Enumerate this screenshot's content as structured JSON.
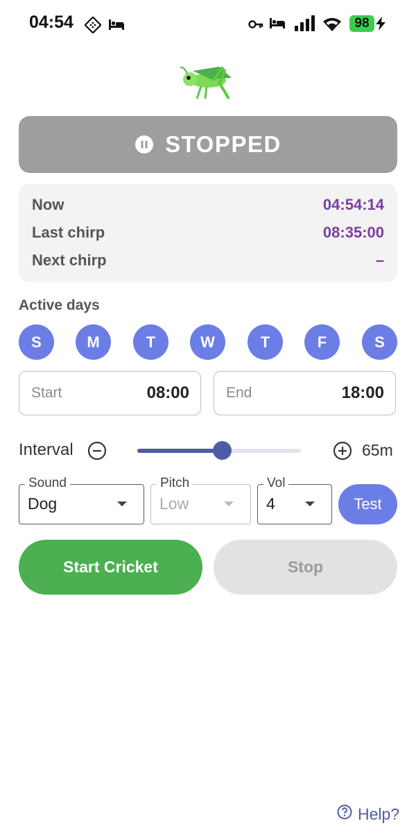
{
  "status_bar": {
    "time": "04:54",
    "battery": "98",
    "icons": [
      "diamond-grid-icon",
      "bed-icon",
      "key-icon",
      "bed-icon",
      "signal-icon",
      "wifi-icon",
      "charging-bolt-icon"
    ]
  },
  "logo": {
    "icon": "grasshopper-icon"
  },
  "status": {
    "label": "STOPPED",
    "icon": "pause-circle-icon",
    "color": "#9e9e9e"
  },
  "info": {
    "rows": [
      {
        "label": "Now",
        "value": "04:54:14"
      },
      {
        "label": "Last chirp",
        "value": "08:35:00"
      },
      {
        "label": "Next chirp",
        "value": "–"
      }
    ],
    "value_color": "#7b3fa0"
  },
  "active_days": {
    "label": "Active days",
    "days": [
      "S",
      "M",
      "T",
      "W",
      "T",
      "F",
      "S"
    ],
    "color": "#6b7ee6"
  },
  "schedule": {
    "start_label": "Start",
    "start_value": "08:00",
    "end_label": "End",
    "end_value": "18:00"
  },
  "interval": {
    "label": "Interval",
    "value": "65m",
    "slider_fraction": 0.52,
    "minus_icon": "minus-circle-icon",
    "plus_icon": "plus-circle-icon"
  },
  "audio": {
    "sound": {
      "label": "Sound",
      "value": "Dog"
    },
    "pitch": {
      "label": "Pitch",
      "value": "Low",
      "disabled": true
    },
    "vol": {
      "label": "Vol",
      "value": "4"
    },
    "test_label": "Test"
  },
  "actions": {
    "start_label": "Start Cricket",
    "stop_label": "Stop",
    "start_color": "#4caf50"
  },
  "help": {
    "label": "Help?",
    "icon": "question-circle-icon"
  }
}
